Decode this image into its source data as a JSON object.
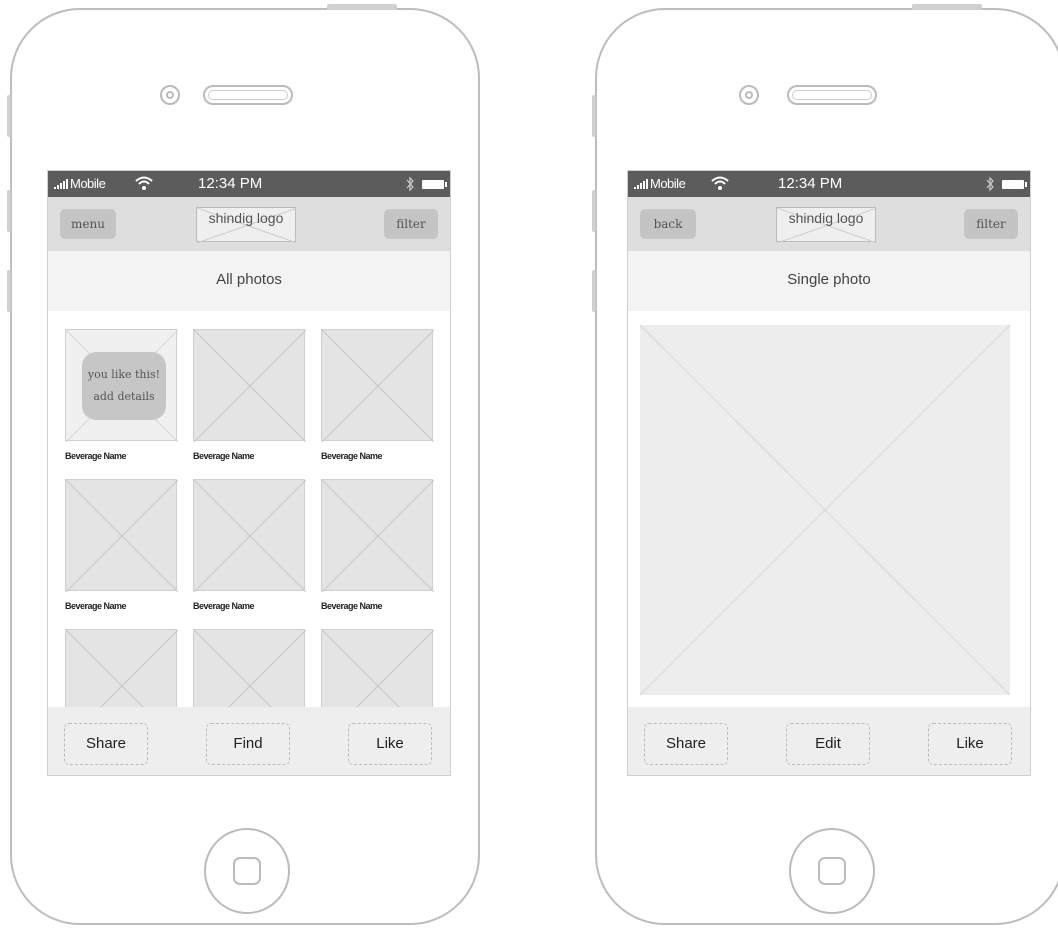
{
  "left_screen": {
    "status": {
      "carrier": "Mobile",
      "time": "12:34 PM"
    },
    "nav": {
      "left_button": "menu",
      "logo": "shindig logo",
      "right_button": "filter"
    },
    "title": "All photos",
    "grid": {
      "overlay_line1": "you like this!",
      "overlay_line2": "add details",
      "items": [
        {
          "label": "Beverage Name"
        },
        {
          "label": "Beverage Name"
        },
        {
          "label": "Beverage Name"
        },
        {
          "label": "Beverage Name"
        },
        {
          "label": "Beverage Name"
        },
        {
          "label": "Beverage Name"
        },
        {
          "label": ""
        },
        {
          "label": ""
        },
        {
          "label": ""
        }
      ]
    },
    "toolbar": {
      "share": "Share",
      "find": "Find",
      "like": "Like"
    }
  },
  "right_screen": {
    "status": {
      "carrier": "Mobile",
      "time": "12:34 PM"
    },
    "nav": {
      "left_button": "back",
      "logo": "shindig logo",
      "right_button": "filter"
    },
    "title": "Single photo",
    "toolbar": {
      "share": "Share",
      "edit": "Edit",
      "like": "Like"
    }
  },
  "icons": [
    "signal-icon",
    "wifi-icon",
    "bluetooth-icon",
    "battery-icon",
    "camera-icon",
    "speaker-icon",
    "home-button-icon"
  ]
}
